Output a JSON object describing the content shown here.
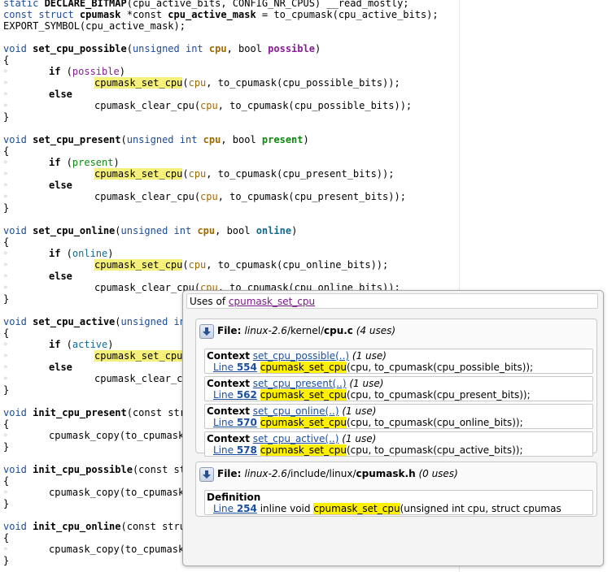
{
  "code": {
    "line_01": {
      "a": "static ",
      "b": "DECLARE_BITMAP",
      "c": "(cpu_active_bits, CONFIG_NR_CPUS) __read_mostly;"
    },
    "line_02": {
      "a": "const struct ",
      "b": "cpumask ",
      "c": "*const ",
      "d": "cpu_active_mask",
      "e": " = to_cpumask(cpu_active_bits);"
    },
    "line_03": "EXPORT_SYMBOL(cpu_active_mask);",
    "funcs": [
      {
        "ret": "void ",
        "name": "set_cpu_possible",
        "open": "(",
        "t1": "unsigned int ",
        "p1": "cpu",
        "sep": ", bool ",
        "p2": "possible",
        "close": ")"
      },
      {
        "ret": "void ",
        "name": "set_cpu_present",
        "open": "(",
        "t1": "unsigned int ",
        "p1": "cpu",
        "sep": ", bool ",
        "p2": "present",
        "close": ")"
      },
      {
        "ret": "void ",
        "name": "set_cpu_online",
        "open": "(",
        "t1": "unsigned int ",
        "p1": "cpu",
        "sep": ", bool ",
        "p2": "online",
        "close": ")"
      },
      {
        "ret": "void ",
        "name": "set_cpu_active",
        "open": "(",
        "t1": "unsigned int",
        "p1": "",
        "sep": "",
        "p2": "",
        "close": ""
      },
      {
        "ret": "void ",
        "name": "init_cpu_present",
        "open": "(const stru",
        "t1": "",
        "p1": "",
        "sep": "",
        "p2": "",
        "close": ""
      },
      {
        "ret": "void ",
        "name": "init_cpu_possible",
        "open": "(const st",
        "t1": "",
        "p1": "",
        "sep": "",
        "p2": "",
        "close": ""
      },
      {
        "ret": "void ",
        "name": "init_cpu_online",
        "open": "(const stru",
        "t1": "",
        "p1": "",
        "sep": "",
        "p2": "",
        "close": ""
      }
    ],
    "brace_open": "{",
    "brace_close": "}",
    "if_kw": "if",
    "else_kw": "else",
    "bodies": [
      {
        "cond": "possible",
        "set": "cpumask_set_cpu",
        "set_rest_a": "(",
        "set_arg": "cpu",
        "set_rest_b": ", to_cpumask(cpu_possible_bits));",
        "clear": "cpumask_clear_cpu(",
        "clear_arg": "cpu",
        "clear_rest": ", to_cpumask(cpu_possible_bits));"
      },
      {
        "cond": "present",
        "set": "cpumask_set_cpu",
        "set_rest_a": "(",
        "set_arg": "cpu",
        "set_rest_b": ", to_cpumask(cpu_present_bits));",
        "clear": "cpumask_clear_cpu(",
        "clear_arg": "cpu",
        "clear_rest": ", to_cpumask(cpu_present_bits));"
      },
      {
        "cond": "online",
        "set": "cpumask_set_cpu",
        "set_rest_a": "(",
        "set_arg": "cpu",
        "set_rest_b": ", to_cpumask(cpu_online_bits));",
        "clear": "cpumask_clear_cpu(",
        "clear_arg": "cpu",
        "clear_rest": ", to_cpumask(cpu_online_bits));"
      },
      {
        "cond": "active",
        "set": "cpumask_set_cpu",
        "set_rest_a": "",
        "set_arg": "",
        "set_rest_b": "",
        "clear": "cpumask_clear_c",
        "clear_arg": "",
        "clear_rest": ""
      }
    ],
    "copy_call": "cpumask_copy(to_cpumask",
    "guide_char": "»"
  },
  "popup": {
    "title_prefix": "Uses of ",
    "title_link": "cpumask_set_cpu",
    "files": [
      {
        "label": "File: ",
        "path": "linux-2.6",
        "path_rest": "/kernel/",
        "file_name": "cpu.c",
        "uses": " (4 uses)",
        "entries": [
          {
            "kind": "Context",
            "ctx_link": "set_cpu_possible(..)",
            "ctx_uses": " (1 use)",
            "line_word": "Line ",
            "line_no": "554",
            "hl": "cpumask_set_cpu",
            "rest": "(cpu, to_cpumask(cpu_possible_bits));"
          },
          {
            "kind": "Context",
            "ctx_link": "set_cpu_present(..)",
            "ctx_uses": " (1 use)",
            "line_word": "Line ",
            "line_no": "562",
            "hl": "cpumask_set_cpu",
            "rest": "(cpu, to_cpumask(cpu_present_bits));"
          },
          {
            "kind": "Context",
            "ctx_link": "set_cpu_online(..)",
            "ctx_uses": " (1 use)",
            "line_word": "Line ",
            "line_no": "570",
            "hl": "cpumask_set_cpu",
            "rest": "(cpu, to_cpumask(cpu_online_bits));"
          },
          {
            "kind": "Context",
            "ctx_link": "set_cpu_active(..)",
            "ctx_uses": " (1 use)",
            "line_word": "Line ",
            "line_no": "578",
            "hl": "cpumask_set_cpu",
            "rest": "(cpu, to_cpumask(cpu_active_bits));"
          }
        ]
      },
      {
        "label": "File: ",
        "path": "linux-2.6",
        "path_rest": "/include/linux/",
        "file_name": "cpumask.h",
        "uses": " (0 uses)",
        "entries": [
          {
            "kind": "Definition",
            "line_word": "Line ",
            "line_no": "254",
            "pre": " inline void ",
            "hl": "cpumask_set_cpu",
            "rest": "(unsigned int cpu, struct cpumas"
          }
        ]
      }
    ]
  },
  "colors": {
    "highlight": "#fff000",
    "link": "#1a4fa0",
    "keyword": "#1e4a96"
  }
}
